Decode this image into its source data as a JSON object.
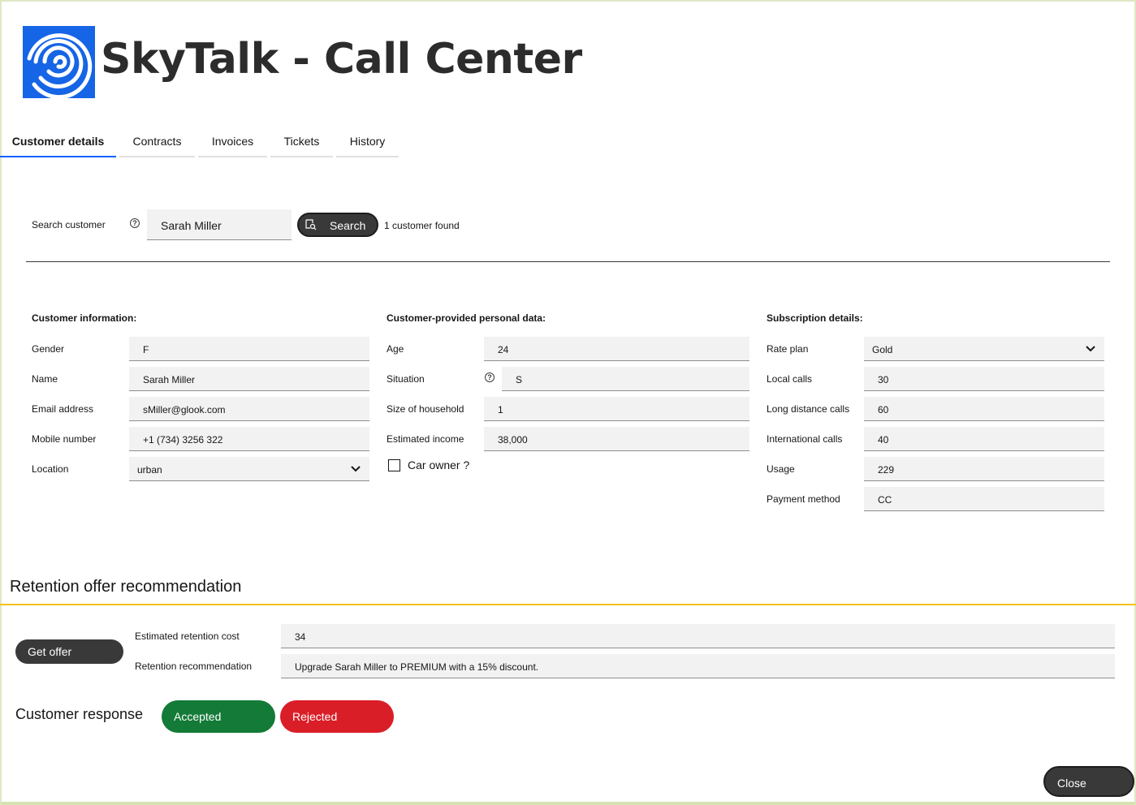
{
  "app": {
    "title": "SkyTalk - Call Center",
    "brand_color": "#1565e6",
    "logo_icon": "skytalk-swirl-logo"
  },
  "tabs": [
    {
      "label": "Customer details",
      "active": true
    },
    {
      "label": "Contracts",
      "active": false
    },
    {
      "label": "Invoices",
      "active": false
    },
    {
      "label": "Tickets",
      "active": false
    },
    {
      "label": "History",
      "active": false
    }
  ],
  "search": {
    "label": "Search customer",
    "help_icon": "?",
    "value": "Sarah Miller",
    "button_label": "Search",
    "result_text": "1 customer found"
  },
  "customer_info": {
    "heading": "Customer information:",
    "fields": [
      {
        "label": "Gender",
        "value": "F"
      },
      {
        "label": "Name",
        "value": "Sarah Miller"
      },
      {
        "label": "Email address",
        "value": "sMiller@glook.com"
      },
      {
        "label": "Mobile number",
        "value": "+1 (734) 3256 322"
      },
      {
        "label": "Location",
        "value": "urban"
      }
    ]
  },
  "personal_data": {
    "heading": "Customer-provided personal data:",
    "fields": [
      {
        "label": "Age",
        "value": "24"
      },
      {
        "label": "Situation",
        "value": "S",
        "help_icon": "?"
      },
      {
        "label": "Size of household",
        "value": "1"
      },
      {
        "label": "Estimated income",
        "value": "38,000"
      }
    ],
    "car_owner_label": "Car owner ?",
    "car_owner_checked": false
  },
  "subscription": {
    "heading": "Subscription details:",
    "fields": [
      {
        "label": "Rate plan",
        "value": "Gold"
      },
      {
        "label": "Local calls",
        "value": "30"
      },
      {
        "label": "Long distance calls",
        "value": "60"
      },
      {
        "label": "International calls",
        "value": "40"
      },
      {
        "label": "Usage",
        "value": "229"
      },
      {
        "label": "Payment method",
        "value": "CC"
      }
    ]
  },
  "retention": {
    "title": "Retention offer recommendation",
    "get_offer_label": "Get offer",
    "cost_label": "Estimated retention cost",
    "cost_value": "34",
    "recommendation_label": "Retention recommendation",
    "recommendation_value": "Upgrade Sarah Miller to PREMIUM with a 15% discount."
  },
  "response": {
    "label": "Customer response",
    "accepted_label": "Accepted",
    "rejected_label": "Rejected",
    "accepted_color": "#137a37",
    "rejected_color": "#da1e28"
  },
  "close_label": "Close"
}
